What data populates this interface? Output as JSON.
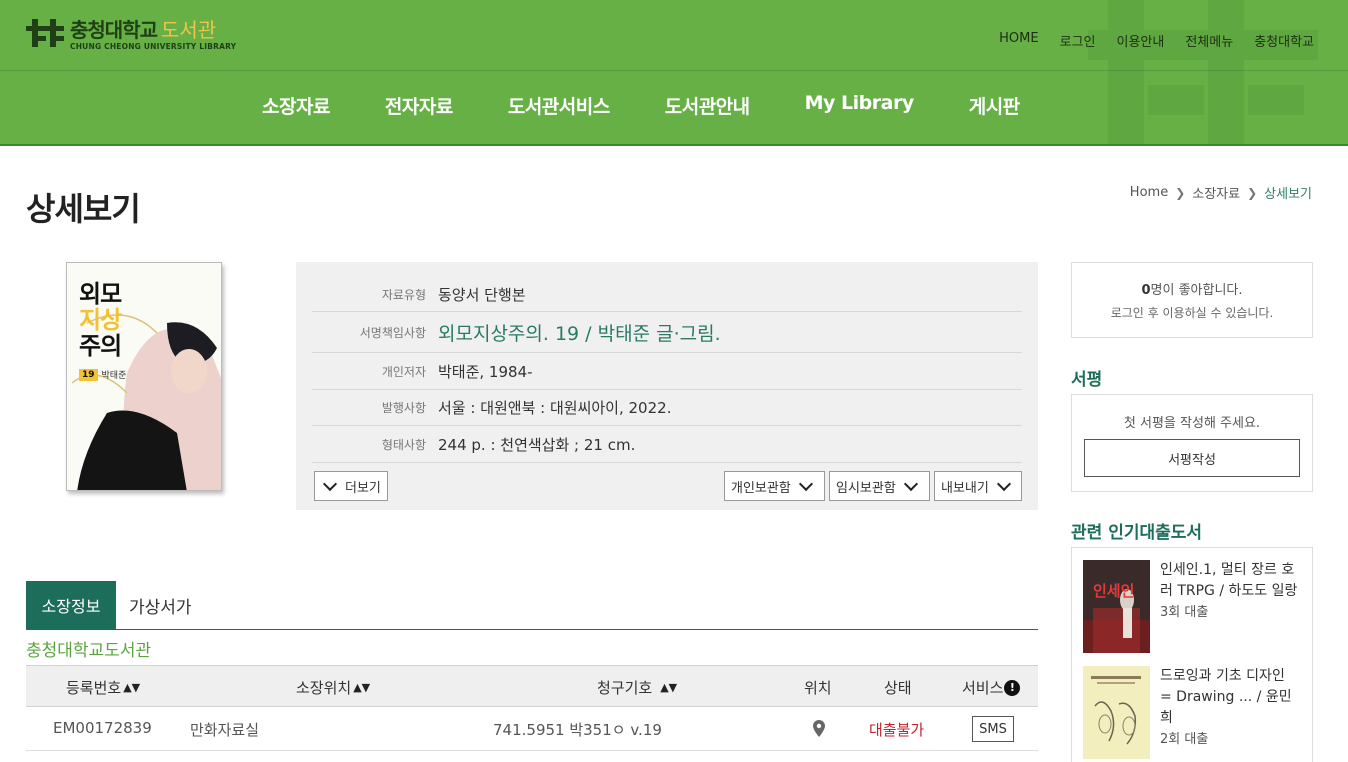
{
  "header": {
    "logo_ko": "충청대학교",
    "logo_lib": "도서관",
    "logo_en": "CHUNG CHEONG UNIVERSITY LIBRARY",
    "util_nav": [
      "HOME",
      "로그인",
      "이용안내",
      "전체메뉴",
      "충청대학교"
    ],
    "main_nav": [
      "소장자료",
      "전자자료",
      "도서관서비스",
      "도서관안내",
      "My Library",
      "게시판"
    ]
  },
  "page": {
    "title": "상세보기",
    "breadcrumb": [
      "Home",
      "소장자료",
      "상세보기"
    ]
  },
  "cover": {
    "line1": "외모",
    "line2": "지상",
    "line3": "주의",
    "volume": "19",
    "author": "박태준"
  },
  "metadata": {
    "rows": [
      {
        "label": "자료유형",
        "value": "동양서 단행본"
      },
      {
        "label": "서명책임사항",
        "value": "외모지상주의.  19 / 박태준 글·그림."
      },
      {
        "label": "개인저자",
        "value": "박태준, 1984-"
      },
      {
        "label": "발행사항",
        "value": "서울 : 대원앤북 : 대원씨아이, 2022."
      },
      {
        "label": "형태사항",
        "value": "244 p. : 천연색삽화 ; 21 cm."
      }
    ],
    "more_label": "더보기",
    "buttons": [
      "개인보관함",
      "임시보관함",
      "내보내기"
    ]
  },
  "tabs": [
    "소장정보",
    "가상서가"
  ],
  "library_name": "충청대학교도서관",
  "table": {
    "headers": [
      "등록번호",
      "소장위치",
      "청구기호",
      "위치",
      "상태",
      "서비스"
    ],
    "rows": [
      {
        "reg_no": "EM00172839",
        "location": "만화자료실",
        "call_no": "741.5951 박351ㅇ v.19",
        "status": "대출불가",
        "service": "SMS"
      }
    ]
  },
  "sidebar": {
    "like_count": "0",
    "like_suffix": "명이 좋아합니다.",
    "like_note": "로그인 후 이용하실 수 있습니다.",
    "review_heading": "서평",
    "review_prompt": "첫 서평을 작성해 주세요.",
    "review_button": "서평작성",
    "popular_heading": "관련 인기대출도서",
    "popular": [
      {
        "title": "인세인.1, 멀티 장르 호러 TRPG / 하도도 일랑",
        "count": "3회 대출",
        "cover_text": "인세인"
      },
      {
        "title": "드로잉과 기초 디자인 = Drawing ... / 윤민희",
        "count": "2회 대출",
        "cover_text": ""
      }
    ]
  },
  "colors": {
    "header_green": "#66b045",
    "accent_teal": "#1c6e5b",
    "status_red": "#c0252e"
  }
}
